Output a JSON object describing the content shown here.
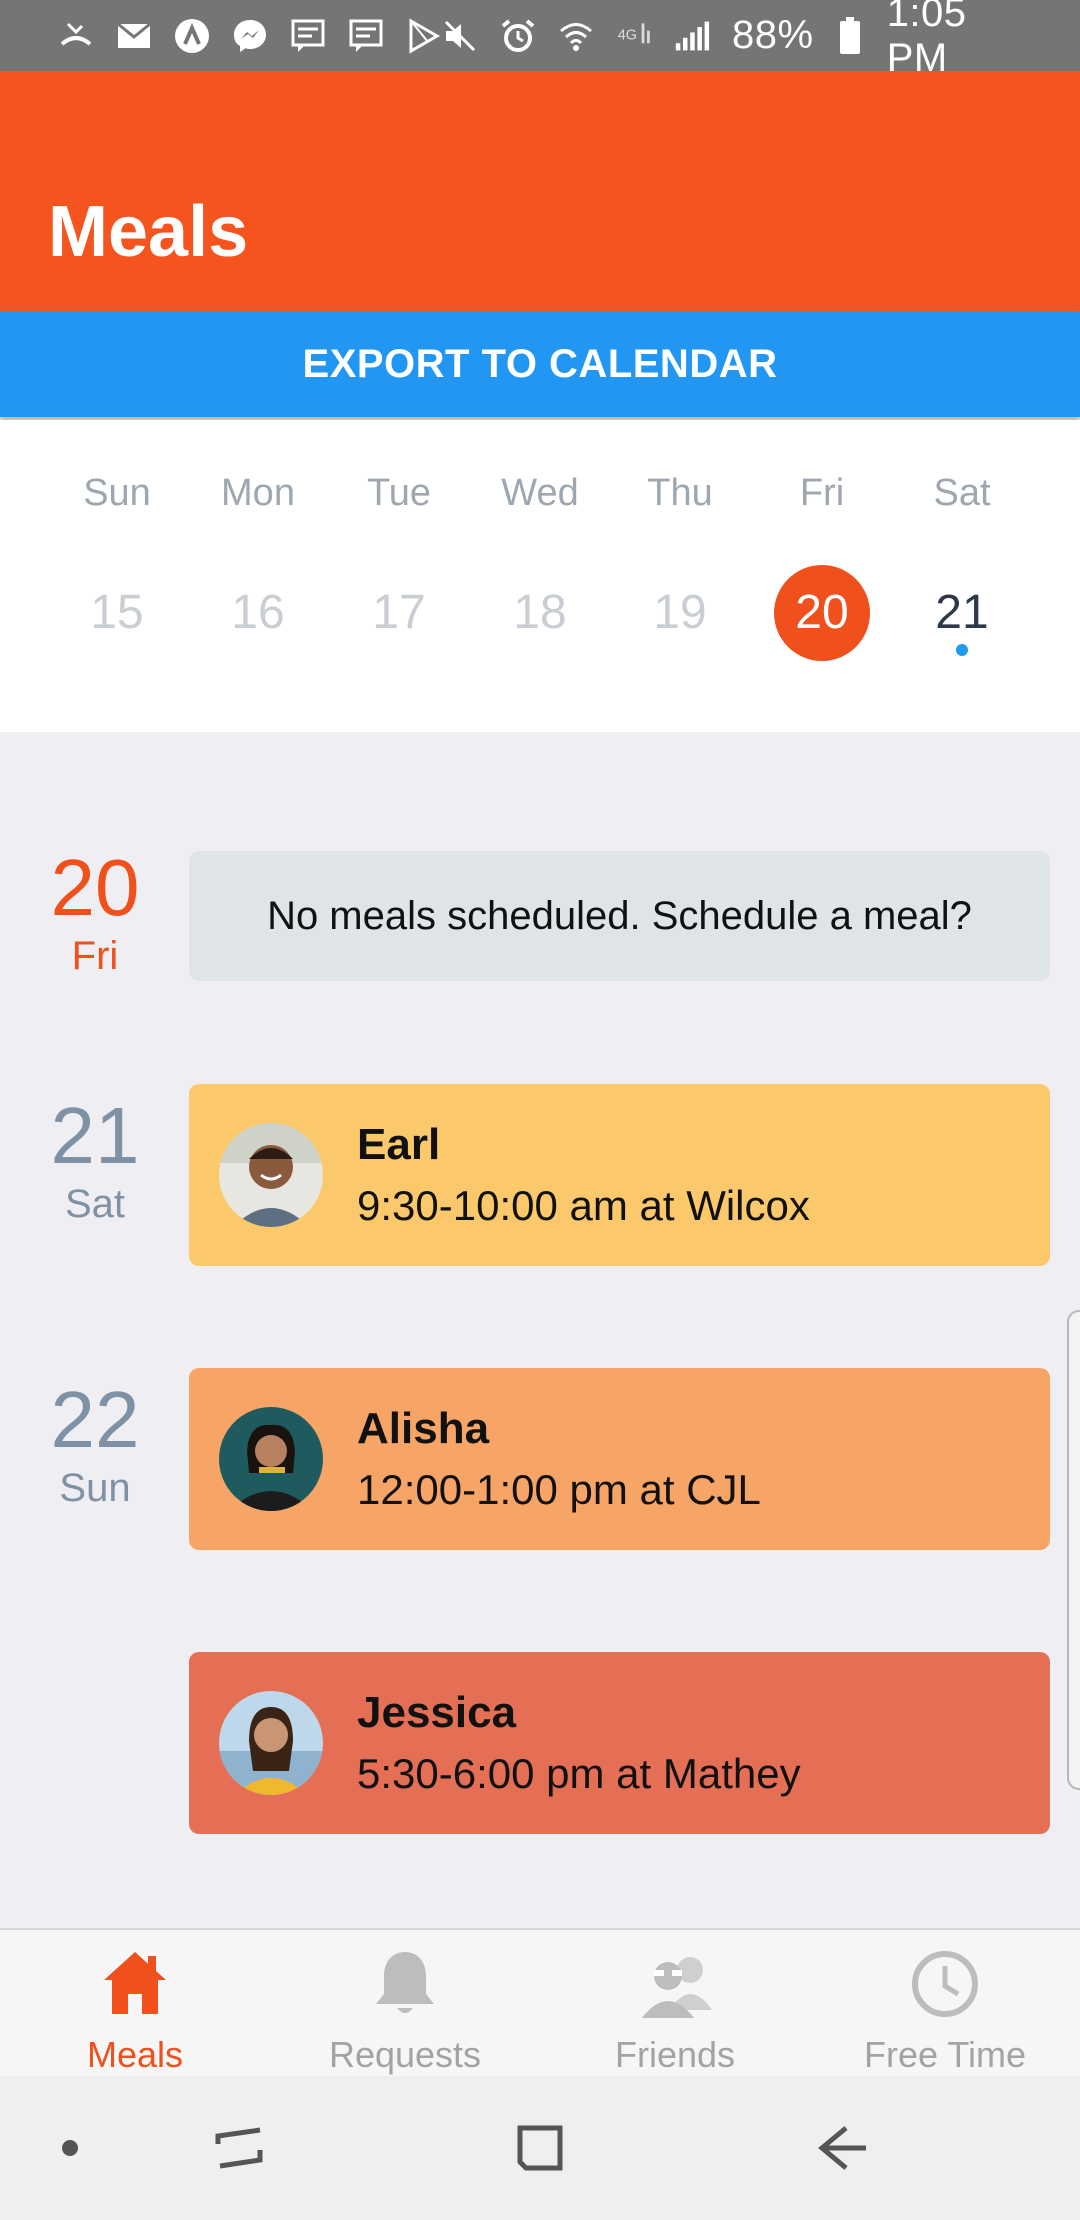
{
  "status_bar": {
    "battery": "88%",
    "time": "1:05 PM",
    "icons_left": [
      "missed-call-icon",
      "mail-icon",
      "app-icon",
      "messenger-icon",
      "message-icon",
      "message-icon",
      "play-store-icon"
    ],
    "icons_right": [
      "mute-icon",
      "alarm-icon",
      "wifi-icon",
      "4g-icon",
      "signal-icon",
      "battery-icon"
    ]
  },
  "header": {
    "title": "Meals"
  },
  "export": {
    "label": "EXPORT TO CALENDAR"
  },
  "week": {
    "days": [
      {
        "name": "Sun",
        "num": "15"
      },
      {
        "name": "Mon",
        "num": "16"
      },
      {
        "name": "Tue",
        "num": "17"
      },
      {
        "name": "Wed",
        "num": "18"
      },
      {
        "name": "Thu",
        "num": "19"
      },
      {
        "name": "Fri",
        "num": "20"
      },
      {
        "name": "Sat",
        "num": "21"
      }
    ],
    "selected": "20",
    "has_event_dot": "21"
  },
  "schedule": {
    "today": {
      "num": "20",
      "name": "Fri",
      "empty_message": "No meals scheduled. Schedule a meal?"
    },
    "meals": [
      {
        "day_num": "21",
        "day_name": "Sat",
        "name": "Earl",
        "time": "9:30-10:00 am at Wilcox",
        "color": "#fbc96b"
      },
      {
        "day_num": "22",
        "day_name": "Sun",
        "name": "Alisha",
        "time": "12:00-1:00 pm at CJL",
        "color": "#f6a567"
      },
      {
        "day_num": "",
        "day_name": "",
        "name": "Jessica",
        "time": "5:30-6:00 pm at Mathey",
        "color": "#e46f55"
      }
    ]
  },
  "bottom_nav": {
    "items": [
      {
        "label": "Meals",
        "icon": "home-icon",
        "active": true
      },
      {
        "label": "Requests",
        "icon": "bell-icon",
        "active": false
      },
      {
        "label": "Friends",
        "icon": "friends-icon",
        "active": false
      },
      {
        "label": "Free Time",
        "icon": "clock-icon",
        "active": false
      }
    ]
  },
  "colors": {
    "header": "#f5541f",
    "accent": "#f0501c",
    "export": "#2196f3"
  }
}
